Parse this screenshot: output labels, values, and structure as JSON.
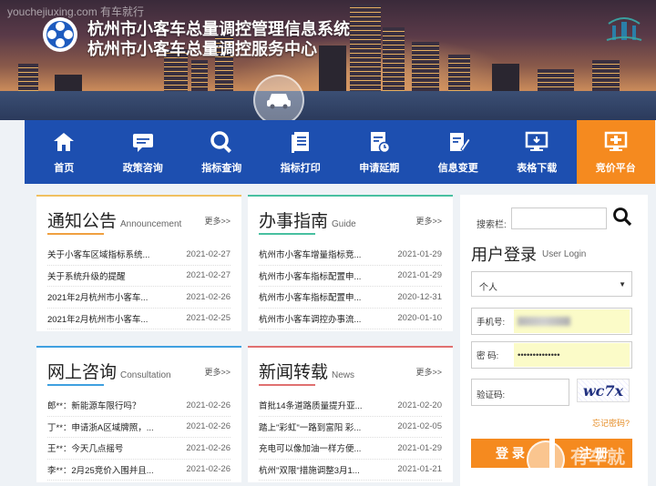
{
  "watermark": {
    "top": "youchejiuxing.com 有车就行",
    "bottom": "有车就"
  },
  "header": {
    "title_line1": "杭州市小客车总量调控管理信息系统",
    "title_line2": "杭州市小客车总量调控服务中心"
  },
  "nav": {
    "items": [
      {
        "label": "首页",
        "icon": "home-icon"
      },
      {
        "label": "政策咨询",
        "icon": "chat-icon"
      },
      {
        "label": "指标查询",
        "icon": "search-icon"
      },
      {
        "label": "指标打印",
        "icon": "document-icon"
      },
      {
        "label": "申请延期",
        "icon": "calendar-clock-icon"
      },
      {
        "label": "信息变更",
        "icon": "edit-icon"
      },
      {
        "label": "表格下载",
        "icon": "monitor-download-icon"
      },
      {
        "label": "竞价平台",
        "icon": "monitor-bid-icon"
      }
    ],
    "active_index": 7
  },
  "panels": {
    "notice": {
      "title": "通知公告",
      "title_en": "Announcement",
      "more": "更多>>",
      "rows": [
        {
          "text": "关于小客车区域指标系统...",
          "date": "2021-02-27"
        },
        {
          "text": "关于系统升级的提醒",
          "date": "2021-02-27"
        },
        {
          "text": "2021年2月杭州市小客车...",
          "date": "2021-02-26"
        },
        {
          "text": "2021年2月杭州市小客车...",
          "date": "2021-02-25"
        }
      ]
    },
    "guide": {
      "title": "办事指南",
      "title_en": "Guide",
      "more": "更多>>",
      "rows": [
        {
          "text": "杭州市小客车增量指标竞...",
          "date": "2021-01-29"
        },
        {
          "text": "杭州市小客车指标配置申...",
          "date": "2021-01-29"
        },
        {
          "text": "杭州市小客车指标配置申...",
          "date": "2020-12-31"
        },
        {
          "text": "杭州市小客车调控办事流...",
          "date": "2020-01-10"
        }
      ]
    },
    "consult": {
      "title": "网上咨询",
      "title_en": "Consultation",
      "more": "更多>>",
      "rows": [
        {
          "text": "郎**：新能源车限行吗？",
          "date": "2021-02-26"
        },
        {
          "text": "丁**：申请浙A区域牌照，...",
          "date": "2021-02-26"
        },
        {
          "text": "王**：今天几点摇号",
          "date": "2021-02-26"
        },
        {
          "text": "李**：2月25竞价入围并且...",
          "date": "2021-02-26"
        }
      ]
    },
    "news": {
      "title": "新闻转载",
      "title_en": "News",
      "more": "更多>>",
      "rows": [
        {
          "text": "首批14条道路质量提升亚...",
          "date": "2021-02-20"
        },
        {
          "text": "踏上\"彩虹\"一路到富阳 彩...",
          "date": "2021-02-05"
        },
        {
          "text": "充电可以像加油一样方便...",
          "date": "2021-01-29"
        },
        {
          "text": "杭州\"双限\"措施调整3月1...",
          "date": "2021-01-21"
        }
      ]
    }
  },
  "login": {
    "search_label": "搜索栏:",
    "search_placeholder": "",
    "title": "用户登录",
    "title_en": "User Login",
    "account_type": "个人",
    "phone_label": "手机号:",
    "password_label": "密 码:",
    "password_value": "••••••••••••••",
    "captcha_label": "验证码:",
    "captcha_text": "wc7x",
    "forgot": "忘记密码?",
    "login_btn": "登 录",
    "register_btn": "注 册"
  },
  "colors": {
    "nav_bg": "#1d4fb0",
    "accent": "#f58a1f"
  }
}
